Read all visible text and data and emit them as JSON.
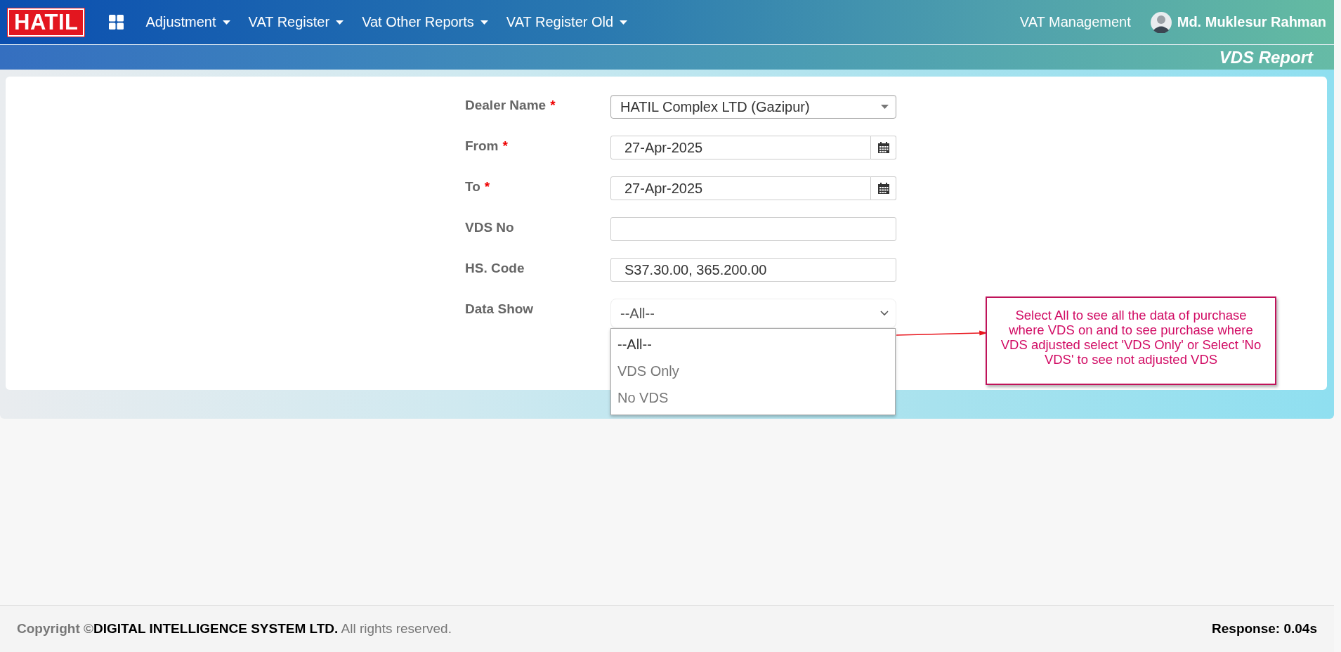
{
  "nav": {
    "logo": "HATIL",
    "menus": [
      {
        "label": "Adjustment"
      },
      {
        "label": "VAT Register"
      },
      {
        "label": "Vat Other Reports"
      },
      {
        "label": "VAT Register Old"
      }
    ],
    "module": "VAT Management",
    "user": "Md. Muklesur Rahman"
  },
  "page_title": "VDS Report",
  "form": {
    "fields": [
      {
        "kind": "select",
        "label": "Dealer Name",
        "required_mark": "*",
        "value": "HATIL Complex LTD (Gazipur)"
      },
      {
        "kind": "date",
        "label": "From",
        "required_mark": "*",
        "value": "27-Apr-2025"
      },
      {
        "kind": "date",
        "label": "To",
        "required_mark": "*",
        "value": "27-Apr-2025"
      },
      {
        "kind": "text",
        "label": "VDS No"
      },
      {
        "kind": "text",
        "label": "HS. Code",
        "value": "S37.30.00, 365.200.00"
      },
      {
        "kind": "dropdown",
        "label": "Data Show",
        "value": "--All--",
        "expanded": true,
        "options": [
          {
            "label": "--All--",
            "selected": true
          },
          {
            "label": "VDS Only",
            "selected": false
          },
          {
            "label": "No VDS",
            "selected": false
          }
        ]
      }
    ]
  },
  "annotation": "Select All to see all the data of purchase where VDS on and to see purchase where VDS adjusted select 'VDS Only' or Select 'No VDS' to see not adjusted VDS",
  "footer": {
    "copyright": "**Copyright ©****DIGITAL INTELLIGENCE SYSTEM LTD.** All rights reserved.",
    "response": "Response: 0.04s"
  }
}
